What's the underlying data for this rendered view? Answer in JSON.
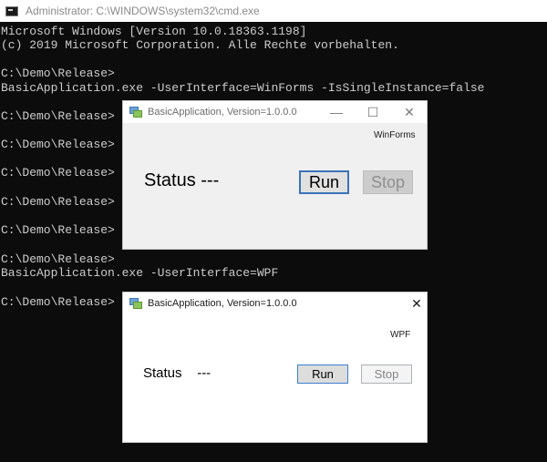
{
  "console": {
    "title": "Administrator: C:\\WINDOWS\\system32\\cmd.exe",
    "lines": [
      "Microsoft Windows [Version 10.0.18363.1198]",
      "(c) 2019 Microsoft Corporation. Alle Rechte vorbehalten.",
      "",
      "C:\\Demo\\Release>",
      "BasicApplication.exe -UserInterface=WinForms -IsSingleInstance=false",
      "",
      "C:\\Demo\\Release>",
      "",
      "C:\\Demo\\Release>",
      "",
      "C:\\Demo\\Release>",
      "",
      "C:\\Demo\\Release>",
      "",
      "C:\\Demo\\Release>",
      "",
      "C:\\Demo\\Release>",
      "BasicApplication.exe -UserInterface=WPF",
      "",
      "C:\\Demo\\Release>"
    ]
  },
  "winforms_window": {
    "title": "BasicApplication, Version=1.0.0.0",
    "minimize_glyph": "—",
    "maximize_glyph": "☐",
    "close_glyph": "✕",
    "ui_label": "WinForms",
    "status_text": "Status ---",
    "run_label": "Run",
    "stop_label": "Stop"
  },
  "wpf_window": {
    "title": "BasicApplication, Version=1.0.0.0",
    "close_glyph": "✕",
    "ui_label": "WPF",
    "status_text": "Status    ---",
    "run_label": "Run",
    "stop_label": "Stop"
  },
  "colors": {
    "console_bg": "#0c0c0c",
    "console_text": "#cccccc",
    "winforms_bg": "#f0f0f0",
    "accent_border": "#3b73b9"
  },
  "icons": {
    "console": "cmd-icon",
    "app": "app-icon"
  }
}
